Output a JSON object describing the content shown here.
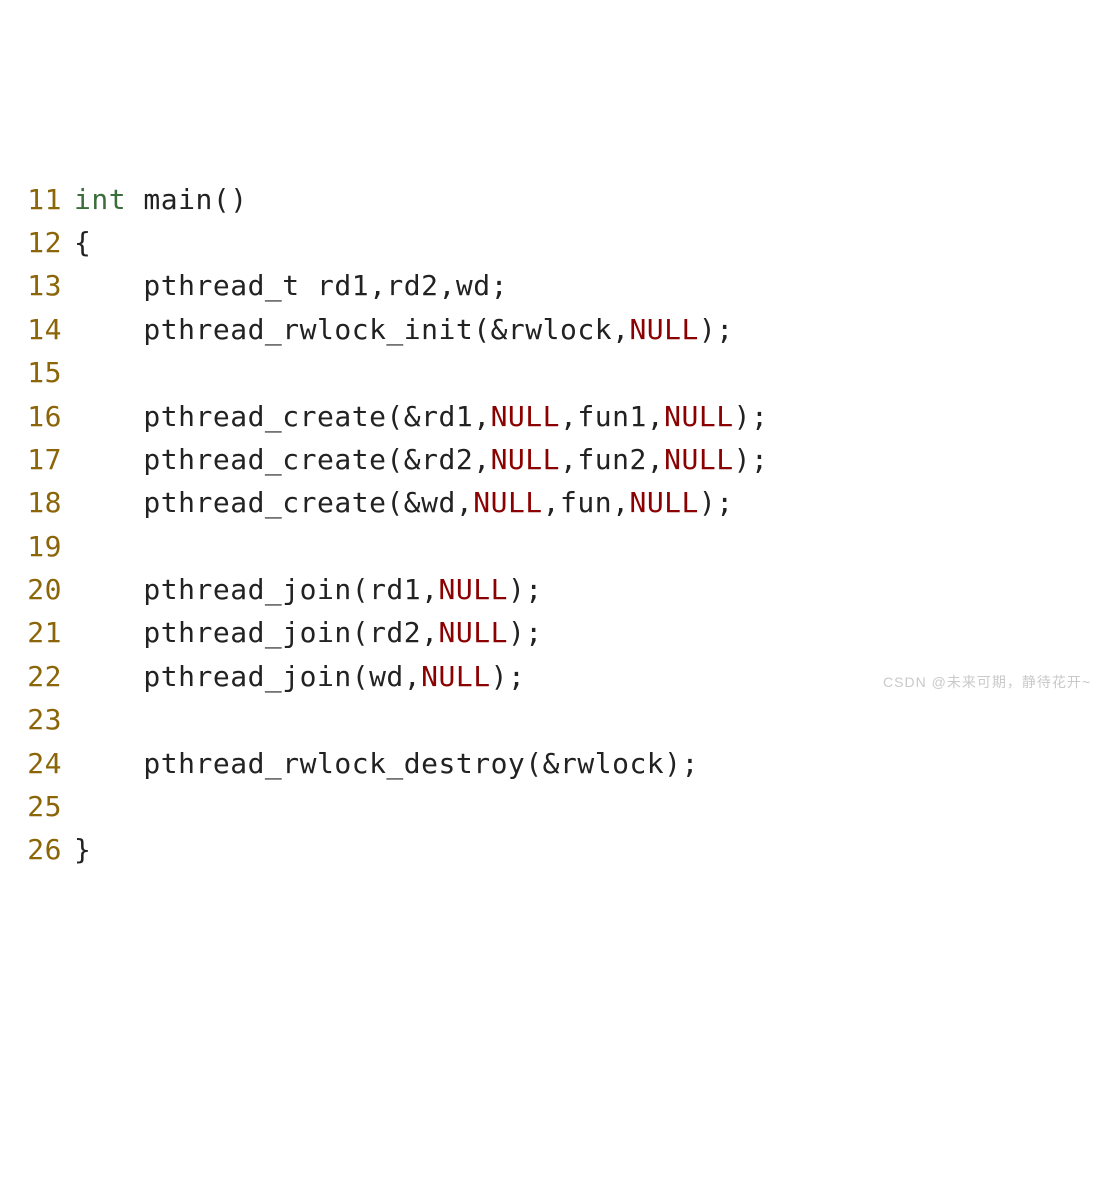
{
  "lines": [
    {
      "num": "11",
      "tokens": [
        {
          "cls": "kw",
          "t": "int"
        },
        {
          "cls": "",
          "t": " main()"
        }
      ]
    },
    {
      "num": "12",
      "tokens": [
        {
          "cls": "",
          "t": "{"
        }
      ]
    },
    {
      "num": "13",
      "tokens": [
        {
          "cls": "",
          "t": "    pthread_t rd1,rd2,wd;"
        }
      ]
    },
    {
      "num": "14",
      "tokens": [
        {
          "cls": "",
          "t": "    pthread_rwlock_init(&rwlock,"
        },
        {
          "cls": "const",
          "t": "NULL"
        },
        {
          "cls": "",
          "t": ");"
        }
      ]
    },
    {
      "num": "15",
      "tokens": [
        {
          "cls": "",
          "t": ""
        }
      ]
    },
    {
      "num": "16",
      "tokens": [
        {
          "cls": "",
          "t": "    pthread_create(&rd1,"
        },
        {
          "cls": "const",
          "t": "NULL"
        },
        {
          "cls": "",
          "t": ",fun1,"
        },
        {
          "cls": "const",
          "t": "NULL"
        },
        {
          "cls": "",
          "t": ");"
        }
      ]
    },
    {
      "num": "17",
      "tokens": [
        {
          "cls": "",
          "t": "    pthread_create(&rd2,"
        },
        {
          "cls": "const",
          "t": "NULL"
        },
        {
          "cls": "",
          "t": ",fun2,"
        },
        {
          "cls": "const",
          "t": "NULL"
        },
        {
          "cls": "",
          "t": ");"
        }
      ]
    },
    {
      "num": "18",
      "tokens": [
        {
          "cls": "",
          "t": "    pthread_create(&wd,"
        },
        {
          "cls": "const",
          "t": "NULL"
        },
        {
          "cls": "",
          "t": ",fun,"
        },
        {
          "cls": "const",
          "t": "NULL"
        },
        {
          "cls": "",
          "t": ");"
        }
      ]
    },
    {
      "num": "19",
      "tokens": [
        {
          "cls": "",
          "t": ""
        }
      ]
    },
    {
      "num": "20",
      "tokens": [
        {
          "cls": "",
          "t": "    pthread_join(rd1,"
        },
        {
          "cls": "const",
          "t": "NULL"
        },
        {
          "cls": "",
          "t": ");"
        }
      ]
    },
    {
      "num": "21",
      "tokens": [
        {
          "cls": "",
          "t": "    pthread_join(rd2,"
        },
        {
          "cls": "const",
          "t": "NULL"
        },
        {
          "cls": "",
          "t": ");"
        }
      ]
    },
    {
      "num": "22",
      "tokens": [
        {
          "cls": "",
          "t": "    pthread_join(wd,"
        },
        {
          "cls": "const",
          "t": "NULL"
        },
        {
          "cls": "",
          "t": ");"
        }
      ]
    },
    {
      "num": "23",
      "tokens": [
        {
          "cls": "",
          "t": ""
        }
      ]
    },
    {
      "num": "24",
      "tokens": [
        {
          "cls": "",
          "t": "    pthread_rwlock_destroy(&rwlock);"
        }
      ]
    },
    {
      "num": "25",
      "tokens": [
        {
          "cls": "",
          "t": ""
        }
      ]
    },
    {
      "num": "26",
      "tokens": [
        {
          "cls": "",
          "t": "}"
        }
      ]
    }
  ],
  "watermark": "CSDN @未来可期，静待花开~"
}
